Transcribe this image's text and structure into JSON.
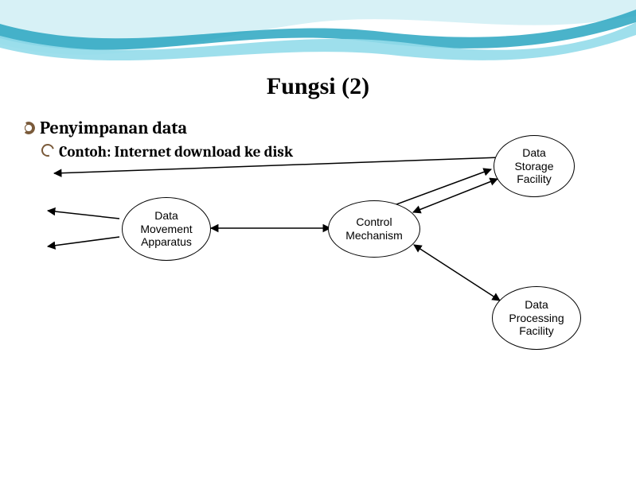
{
  "title": "Fungsi (2)",
  "bullets": {
    "level1": "Penyimpanan data",
    "level2": "Contoh: Internet download ke disk"
  },
  "nodes": {
    "dataMovement": "Data\nMovement\nApparatus",
    "controlMechanism": "Control\nMechanism",
    "dataStorage": "Data\nStorage\nFacility",
    "dataProcessing": "Data\nProcessing\nFacility"
  },
  "colors": {
    "waveLight": "#bfe8ef",
    "waveAccent": "#2aa6c1",
    "text": "#000000"
  }
}
